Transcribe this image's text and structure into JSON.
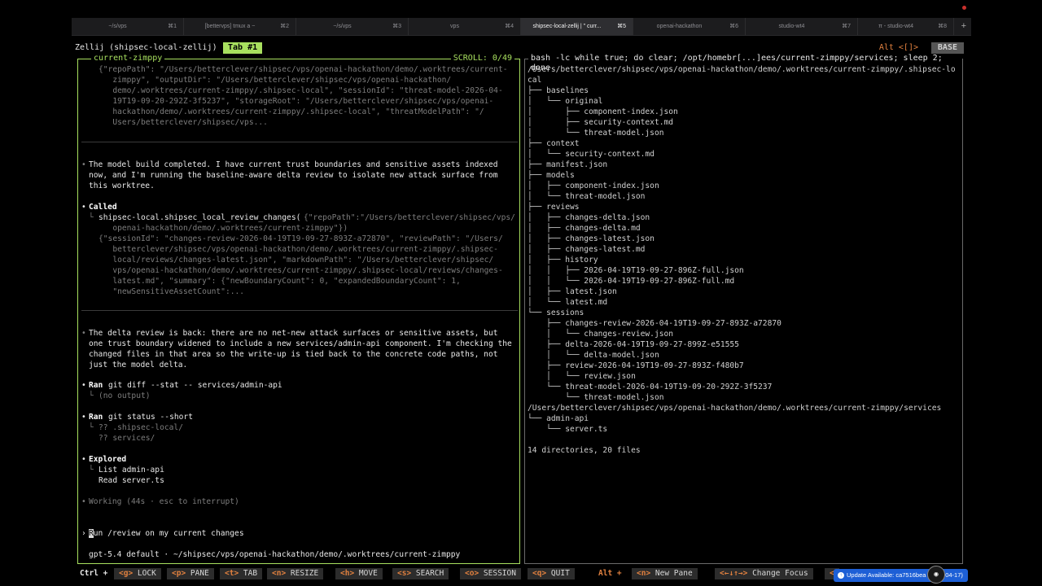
{
  "window_tabs": [
    {
      "title": "~/s/vps",
      "key": "⌘1",
      "active": false
    },
    {
      "title": "[bettervps] tmux a ~",
      "key": "⌘2",
      "active": false
    },
    {
      "title": "~/s/vps",
      "key": "⌘3",
      "active": false
    },
    {
      "title": "vps",
      "key": "⌘4",
      "active": false
    },
    {
      "title": "shipsec-local-zellij | \" curr...",
      "key": "⌘5",
      "active": true
    },
    {
      "title": "openai-hackathon",
      "key": "⌘6",
      "active": false
    },
    {
      "title": "studio-wt4",
      "key": "⌘7",
      "active": false
    },
    {
      "title": "π - studio-wt4",
      "key": "⌘8",
      "active": false
    }
  ],
  "new_tab_label": "+",
  "zellij": {
    "session_label": "Zellij (shipsec-local-zellij)",
    "tab_label": "Tab #1",
    "alt_hint": "Alt <[]>",
    "mode": "BASE"
  },
  "left_pane": {
    "title": "current-zimppy",
    "scroll": "SCROLL:  0/49",
    "block1_lines": [
      "{\"repoPath\": \"/Users/betterclever/shipsec/vps/openai-hackathon/demo/.worktrees/current-",
      "   zimppy\", \"outputDir\": \"/Users/betterclever/shipsec/vps/openai-hackathon/",
      "   demo/.worktrees/current-zimppy/.shipsec-local\", \"sessionId\": \"threat-model-2026-04-",
      "   19T19-09-20-292Z-3f5237\", \"storageRoot\": \"/Users/betterclever/shipsec/vps/openai-",
      "   hackathon/demo/.worktrees/current-zimppy/.shipsec-local\", \"threatModelPath\": \"/",
      "   Users/betterclever/shipsec/vps..."
    ],
    "msg1_lines": [
      "The model build completed. I have current trust boundaries and sensitive assets indexed",
      "now, and I'm running the baseline-aware delta review to isolate new attack surface from",
      "this worktree."
    ],
    "called_label": "Called",
    "call_fn": "shipsec-local.shipsec_local_review_changes(",
    "call_args1": "{\"repoPath\":\"/Users/betterclever/shipsec/vps/",
    "call_args2": "   openai-hackathon/demo/.worktrees/current-zimppy\"})",
    "result_lines": [
      "{\"sessionId\": \"changes-review-2026-04-19T19-09-27-893Z-a72870\", \"reviewPath\": \"/Users/",
      "   betterclever/shipsec/vps/openai-hackathon/demo/.worktrees/current-zimppy/.shipsec-",
      "   local/reviews/changes-latest.json\", \"markdownPath\": \"/Users/betterclever/shipsec/",
      "   vps/openai-hackathon/demo/.worktrees/current-zimppy/.shipsec-local/reviews/changes-",
      "   latest.md\", \"summary\": {\"newBoundaryCount\": 0, \"expandedBoundaryCount\": 1,",
      "   \"newSensitiveAssetCount\":..."
    ],
    "msg2_lines": [
      "The delta review is back: there are no net-new attack surfaces or sensitive assets, but",
      "one trust boundary widened to include a new services/admin-api component. I'm checking the",
      "changed files in that area so the write-up is tied back to the concrete code paths, not",
      "just the model delta."
    ],
    "ran1_label": "Ran",
    "ran1_cmd": "git diff --stat -- services/admin-api",
    "ran1_out": "(no output)",
    "ran2_label": "Ran",
    "ran2_cmd": "git status --short",
    "ran2_out1": "?? .shipsec-local/",
    "ran2_out2": "?? services/",
    "explored_label": "Explored",
    "explored1": "List admin-api",
    "explored2": "Read server.ts",
    "working": "Working (44s · esc to interrupt)",
    "prompt_symbol": "›",
    "prompt_first": "R",
    "prompt_rest": "un /review on my current changes",
    "footer": "gpt-5.4 default · ~/shipsec/vps/openai-hackathon/demo/.worktrees/current-zimppy"
  },
  "right_pane": {
    "title": "bash -lc while true; do clear; /opt/homebr[...]ees/current-zimppy/services; sleep 2; done",
    "tree_lines": [
      "/Users/betterclever/shipsec/vps/openai-hackathon/demo/.worktrees/current-zimppy/.shipsec-lo",
      "cal",
      "├── baselines",
      "│   └── original",
      "│       ├── component-index.json",
      "│       ├── security-context.md",
      "│       └── threat-model.json",
      "├── context",
      "│   └── security-context.md",
      "├── manifest.json",
      "├── models",
      "│   ├── component-index.json",
      "│   └── threat-model.json",
      "├── reviews",
      "│   ├── changes-delta.json",
      "│   ├── changes-delta.md",
      "│   ├── changes-latest.json",
      "│   ├── changes-latest.md",
      "│   ├── history",
      "│   │   ├── 2026-04-19T19-09-27-896Z-full.json",
      "│   │   └── 2026-04-19T19-09-27-896Z-full.md",
      "│   ├── latest.json",
      "│   └── latest.md",
      "└── sessions",
      "    ├── changes-review-2026-04-19T19-09-27-893Z-a72870",
      "    │   └── changes-review.json",
      "    ├── delta-2026-04-19T19-09-27-899Z-e51555",
      "    │   └── delta-model.json",
      "    ├── review-2026-04-19T19-09-27-893Z-f480b7",
      "    │   └── review.json",
      "    └── threat-model-2026-04-19T19-09-20-292Z-3f5237",
      "        └── threat-model.json",
      "/Users/betterclever/shipsec/vps/openai-hackathon/demo/.worktrees/current-zimppy/services",
      "└── admin-api",
      "    └── server.ts",
      "",
      "14 directories, 20 files"
    ]
  },
  "status_bar": {
    "ctrl_label": "Ctrl +",
    "keys": [
      {
        "key": "<g>",
        "label": "LOCK"
      },
      {
        "key": "<p>",
        "label": "PANE"
      },
      {
        "key": "<t>",
        "label": "TAB"
      },
      {
        "key": "<n>",
        "label": "RESIZE"
      },
      {
        "key": "<h>",
        "label": "MOVE"
      },
      {
        "key": "<s>",
        "label": "SEARCH"
      },
      {
        "key": "<o>",
        "label": "SESSION"
      },
      {
        "key": "<q>",
        "label": "QUIT"
      }
    ],
    "alt_label": "Alt +",
    "alt_keys": [
      {
        "key": "<n>",
        "label": "New Pane"
      },
      {
        "key": "<←↓↑→>",
        "label": "Change Focus"
      },
      {
        "key": "<",
        "label": ""
      }
    ]
  },
  "update_notice": "Update Available: ca7516bea (2026-04-17)",
  "avatar_icon": "user-avatar-icon"
}
